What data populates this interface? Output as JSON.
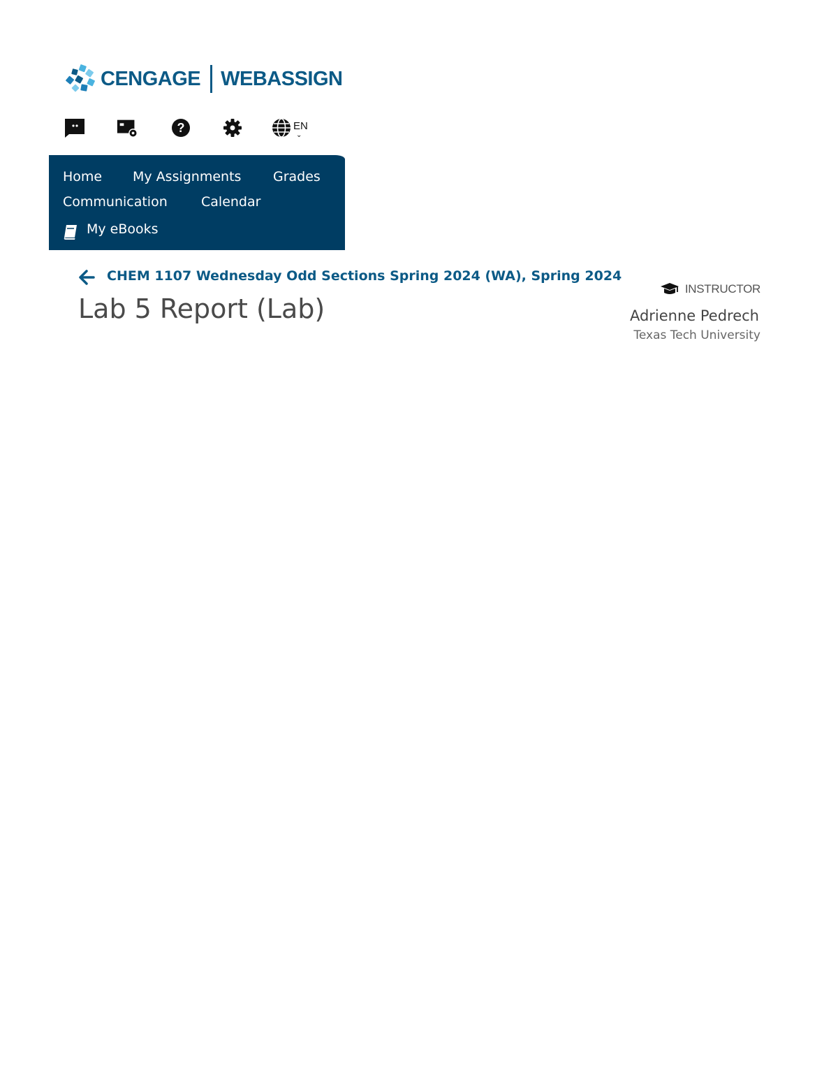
{
  "header": {
    "brand_left": "CENGAGE",
    "brand_right": "WEBASSIGN",
    "brand_color": "#0c5a86"
  },
  "toolbar": {
    "icons": [
      "message-flag-icon",
      "card-settings-icon",
      "help-icon",
      "settings-gear-icon",
      "globe-icon"
    ],
    "language": "EN"
  },
  "nav": {
    "background": "#003d63",
    "items": [
      {
        "label": "Home"
      },
      {
        "label": "My Assignments"
      },
      {
        "label": "Grades"
      },
      {
        "label": "Communication"
      },
      {
        "label": "Calendar"
      },
      {
        "label": "My eBooks"
      }
    ]
  },
  "breadcrumb": {
    "course": "CHEM 1107 Wednesday Odd Sections Spring 2024 (WA), Spring 2024"
  },
  "page": {
    "title": "Lab 5 Report (Lab)"
  },
  "user": {
    "role": "INSTRUCTOR",
    "name": "Adrienne Pedrech",
    "school": "Texas Tech University"
  }
}
